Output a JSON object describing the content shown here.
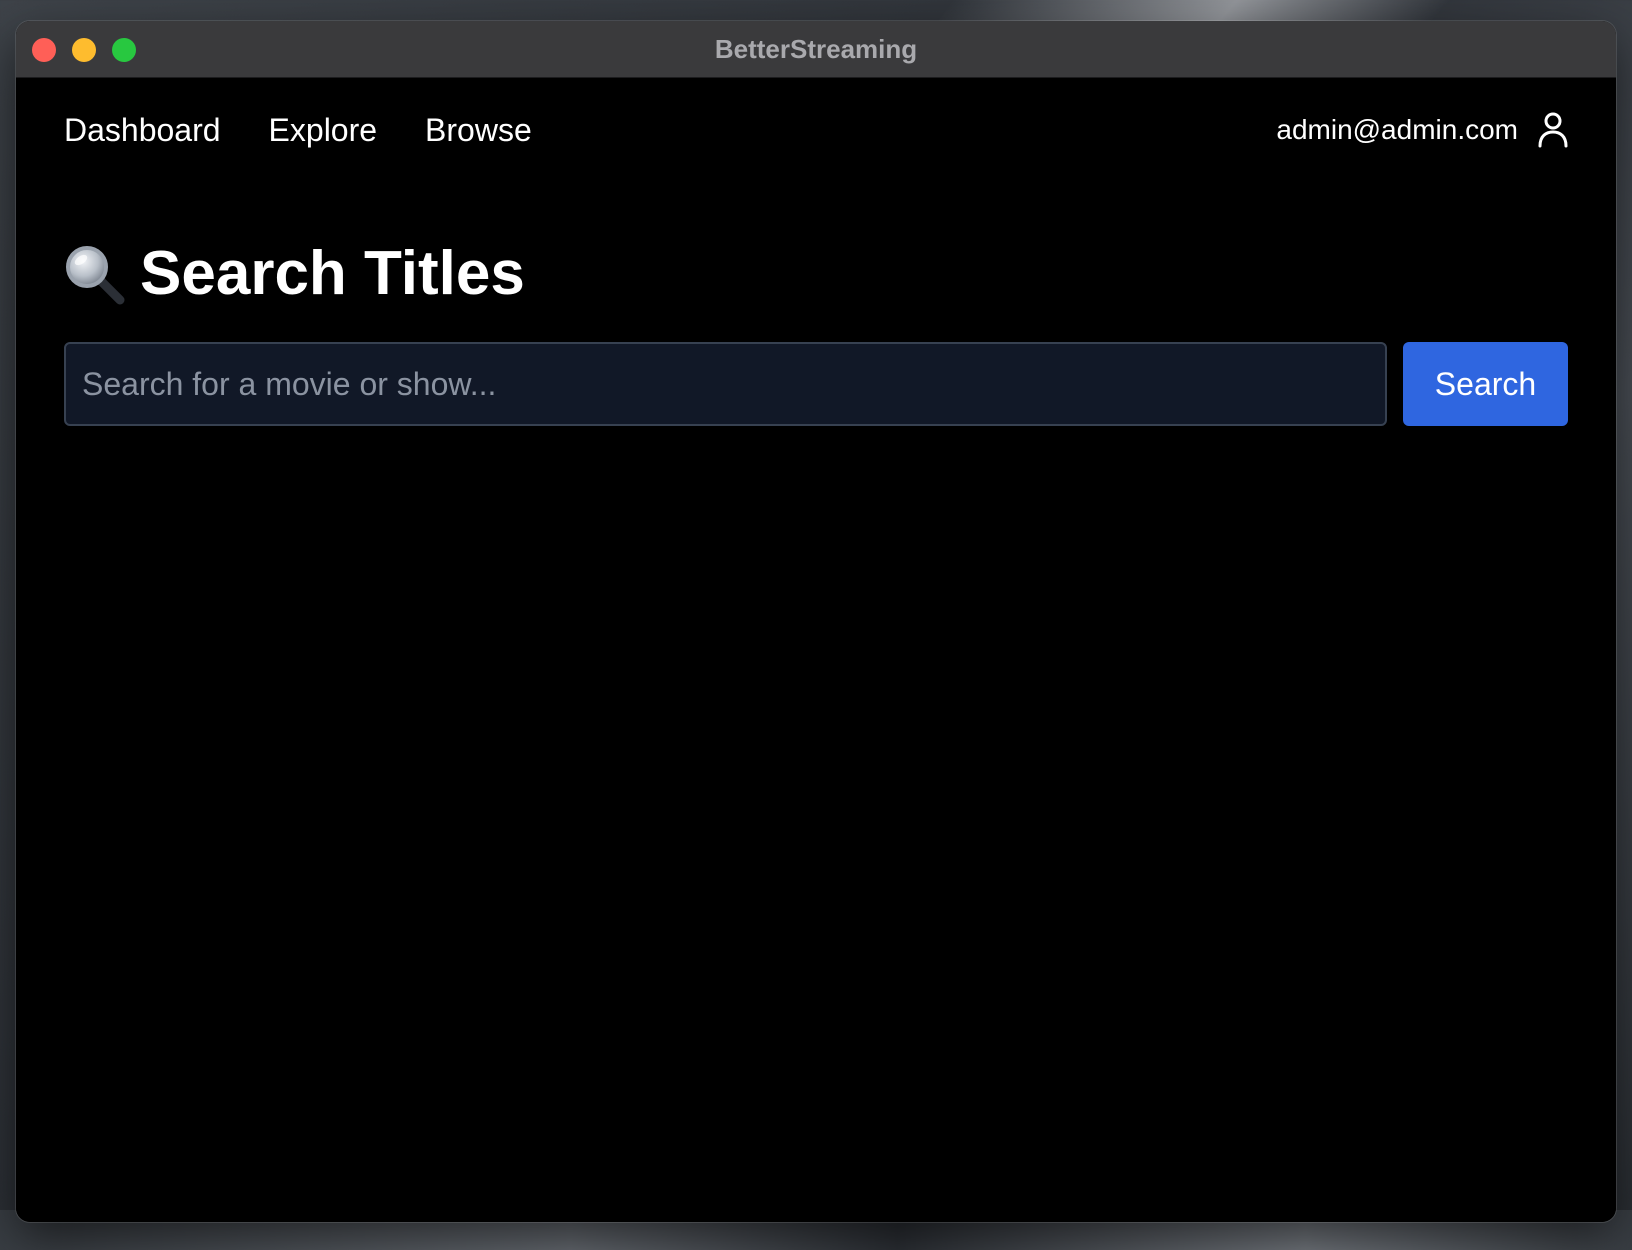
{
  "window": {
    "title": "BetterStreaming"
  },
  "nav": {
    "items": [
      {
        "label": "Dashboard"
      },
      {
        "label": "Explore"
      },
      {
        "label": "Browse"
      }
    ]
  },
  "user": {
    "email": "admin@admin.com",
    "icon": "user-icon"
  },
  "page": {
    "title_icon": "magnifying-glass-icon",
    "title": "Search Titles"
  },
  "search": {
    "value": "",
    "placeholder": "Search for a movie or show...",
    "button_label": "Search"
  },
  "colors": {
    "background": "#000000",
    "titlebar": "#3a3a3c",
    "input_background": "#111827",
    "input_border": "#374151",
    "accent": "#2f66e0"
  }
}
